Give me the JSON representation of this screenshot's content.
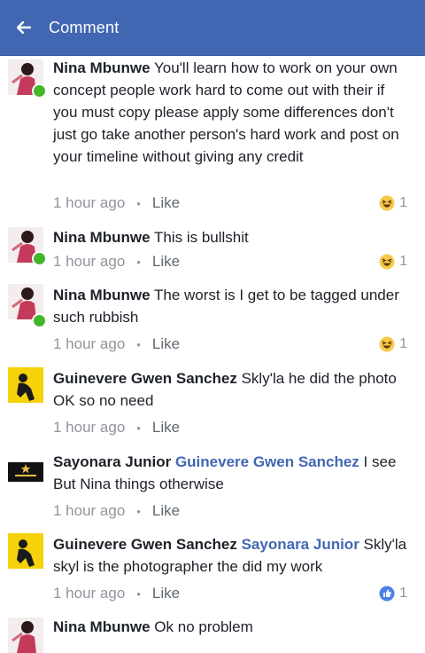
{
  "header": {
    "title": "Comment",
    "back_icon": "arrow-left-icon",
    "color": "#4267b2"
  },
  "comments": [
    {
      "author": "Nina Mbunwe",
      "text": "You'll learn how to work on your own concept people work hard to come out with their if you must copy please apply some differences don't just go take another person's hard work and post on your timeline without giving any credit",
      "time": "1 hour ago",
      "like": "Like",
      "reaction_icon": "haha-icon",
      "reaction_count": "1"
    },
    {
      "author": "Nina Mbunwe",
      "text": "This is bullshit",
      "time": "1 hour ago",
      "like": "Like",
      "reaction_icon": "haha-icon",
      "reaction_count": "1"
    },
    {
      "author": "Nina Mbunwe",
      "text": "The worst is I get to be tagged under such rubbish",
      "time": "1 hour ago",
      "like": "Like",
      "reaction_icon": "haha-icon",
      "reaction_count": "1"
    },
    {
      "author": "Guinevere Gwen Sanchez",
      "text": "Skly'la he did the photo OK so no need",
      "time": "1 hour ago",
      "like": "Like"
    },
    {
      "author": "Sayonara Junior",
      "mention": "Guinevere Gwen Sanchez",
      "text": "I see But Nina things otherwise",
      "time": "1 hour ago",
      "like": "Like"
    },
    {
      "author": "Guinevere Gwen Sanchez",
      "mention": "Sayonara Junior",
      "text": "Skly'la skyl is the photographer the did my work",
      "time": "1 hour ago",
      "like": "Like",
      "reaction_icon": "like-icon",
      "reaction_count": "1"
    },
    {
      "author": "Nina Mbunwe",
      "text": "Ok no problem"
    }
  ],
  "colors": {
    "online": "#42b72a",
    "meta": "#90949c",
    "mention": "#4267b2"
  }
}
